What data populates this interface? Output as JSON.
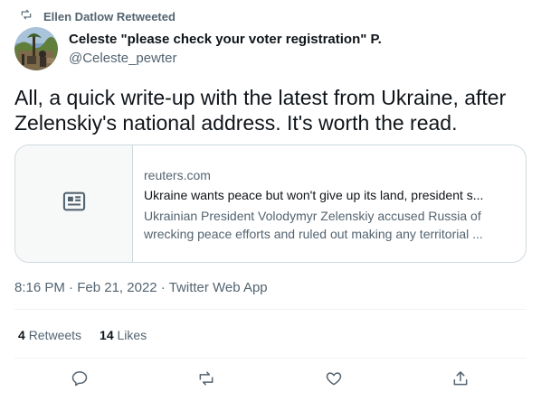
{
  "retweet": {
    "text": "Ellen Datlow Retweeted",
    "icon": "retweet-icon"
  },
  "author": {
    "display_name": "Celeste \"please check your voter registration\" P.",
    "handle": "@Celeste_pewter"
  },
  "tweet": {
    "text": "All, a quick write-up with the latest from Ukraine, after Zelenskiy's national address. It's worth the read."
  },
  "card": {
    "domain": "reuters.com",
    "title": "Ukraine wants peace but won't give up its land, president s...",
    "description": "Ukrainian President Volodymyr Zelenskiy accused Russia of wrecking peace efforts and ruled out making any territorial ...",
    "thumb_icon": "news-article-icon"
  },
  "meta": {
    "time": "8:16 PM",
    "date": "Feb 21, 2022",
    "source": "Twitter Web App",
    "separator": "·"
  },
  "stats": {
    "retweets_count": "4",
    "retweets_label": "Retweets",
    "likes_count": "14",
    "likes_label": "Likes"
  },
  "actions": {
    "reply_icon": "reply-icon",
    "retweet_icon": "retweet-icon",
    "like_icon": "heart-icon",
    "share_icon": "share-icon"
  },
  "colors": {
    "text_primary": "#0f1419",
    "text_secondary": "#536471",
    "border": "#cfd9de",
    "divider": "#eff3f4",
    "card_thumb_bg": "#f7f9f9"
  }
}
